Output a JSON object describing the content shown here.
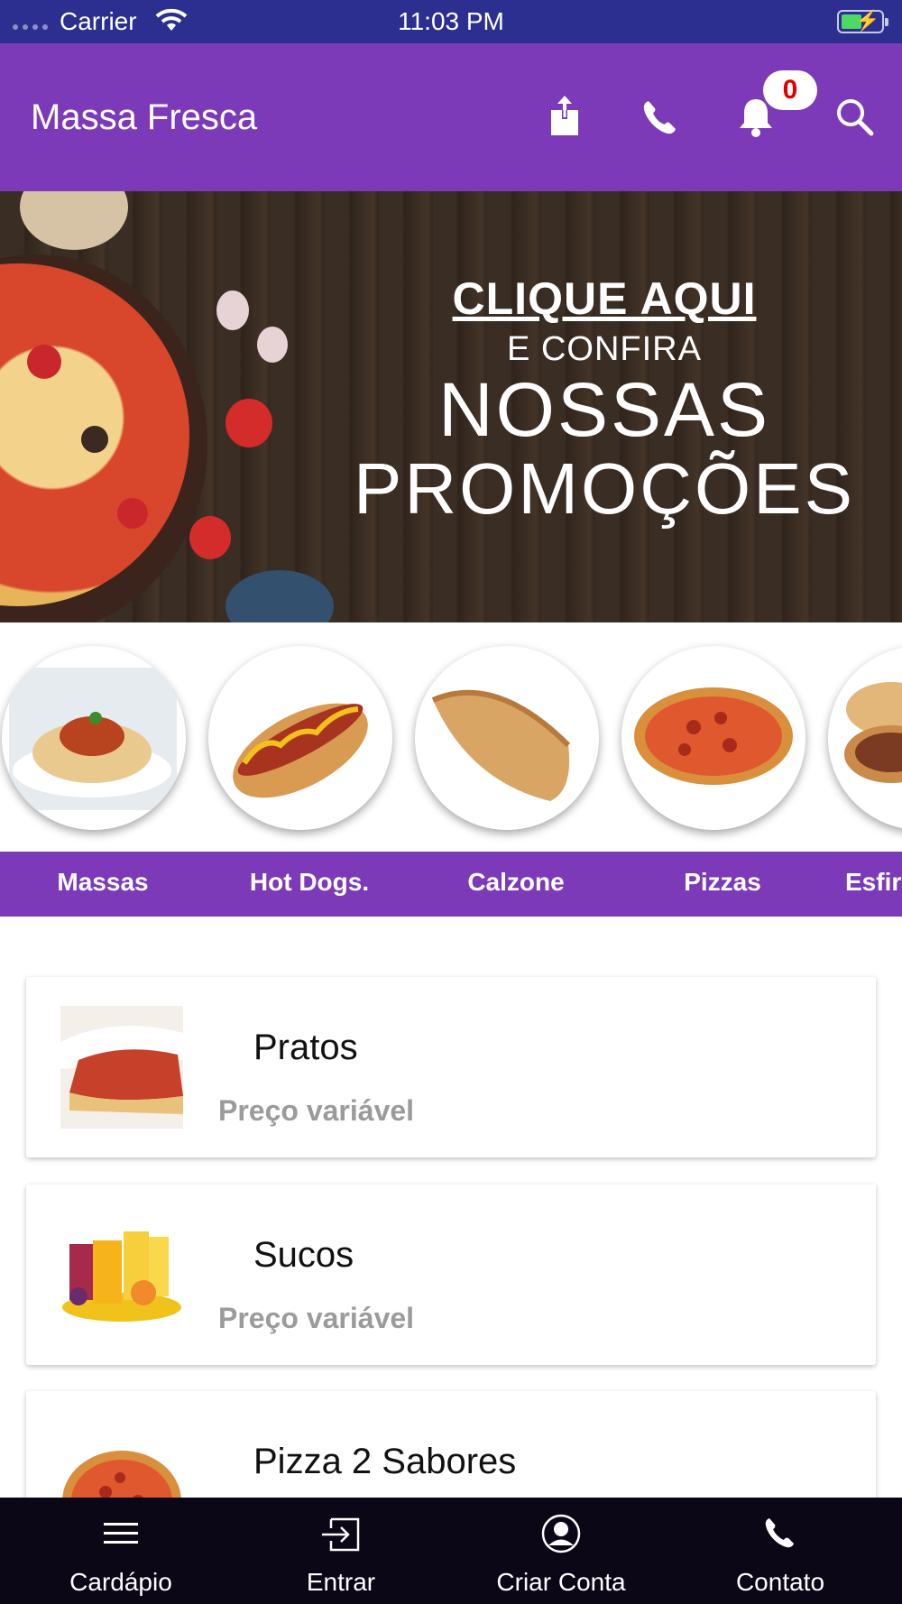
{
  "status_bar": {
    "carrier": "Carrier",
    "time": "11:03 PM"
  },
  "app_bar": {
    "title": "Massa Fresca",
    "notification_count": "0",
    "icons": [
      "share-icon",
      "phone-icon",
      "bell-icon",
      "search-icon"
    ]
  },
  "promo": {
    "line1": "CLIQUE AQUI",
    "line2": "E CONFIRA",
    "line3": "NOSSAS",
    "line4": "PROMOÇÕES"
  },
  "categories": [
    {
      "label": "Massas"
    },
    {
      "label": "Hot Dogs."
    },
    {
      "label": "Calzone"
    },
    {
      "label": "Pizzas"
    },
    {
      "label": "Esfir"
    }
  ],
  "products": [
    {
      "name": "Pratos",
      "price": "Preço variável"
    },
    {
      "name": "Sucos",
      "price": "Preço variável"
    },
    {
      "name": "Pizza 2 Sabores"
    }
  ],
  "bottom_nav": [
    {
      "label": "Cardápio",
      "icon": "menu-icon"
    },
    {
      "label": "Entrar",
      "icon": "login-icon"
    },
    {
      "label": "Criar Conta",
      "icon": "user-icon"
    },
    {
      "label": "Contato",
      "icon": "phone-icon"
    }
  ],
  "colors": {
    "status_bar": "#2c2f8f",
    "primary": "#7c3ab8",
    "badge_text": "#e00000",
    "bottom_nav": "#0c0716",
    "price_text": "#9b9b9b"
  }
}
